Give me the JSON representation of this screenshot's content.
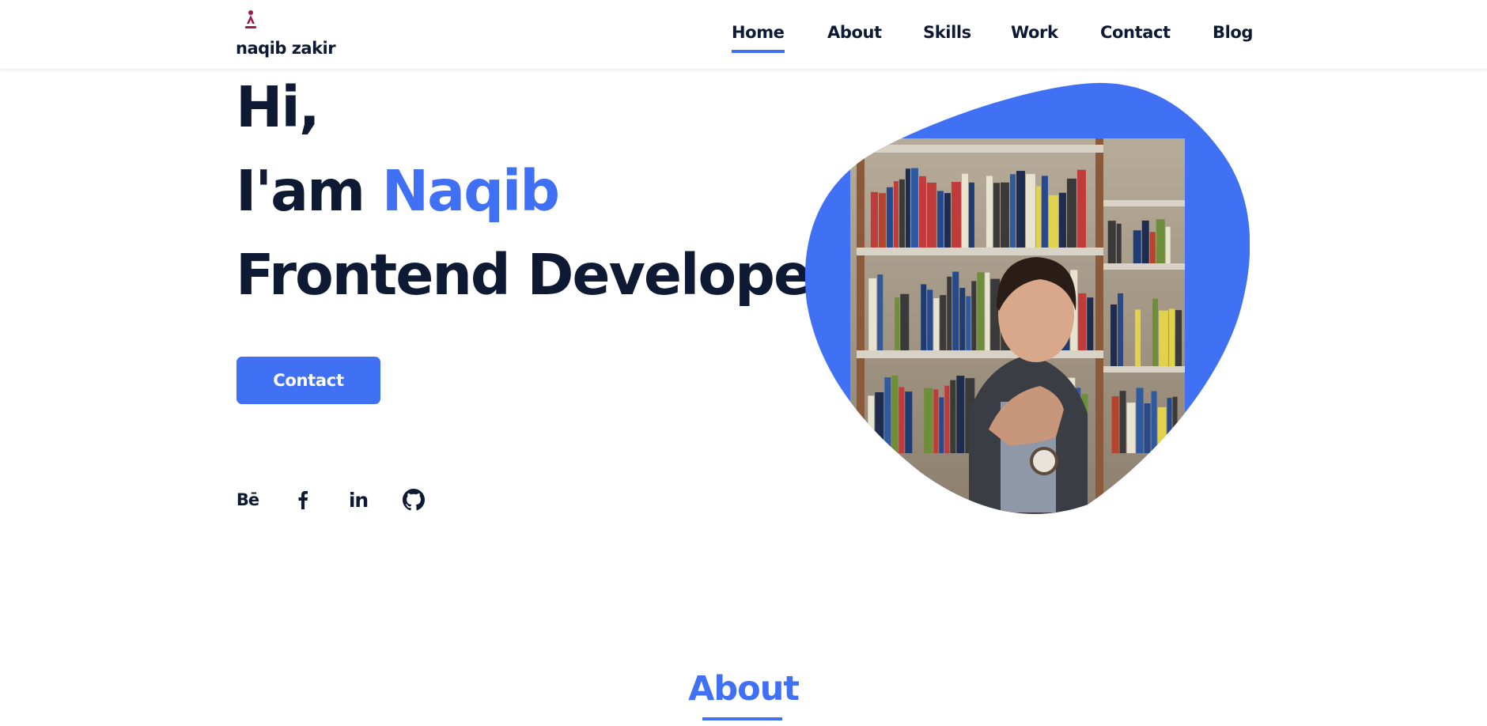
{
  "colors": {
    "accent": "#4070f4",
    "text": "#0e1a33",
    "background": "#ffffff"
  },
  "header": {
    "logo_icon": "naqib-logo-icon",
    "brand_name": "naqib zakir",
    "nav": [
      {
        "label": "Home",
        "active": true
      },
      {
        "label": "About",
        "active": false
      },
      {
        "label": "Skills",
        "active": false
      },
      {
        "label": "Work",
        "active": false
      },
      {
        "label": "Contact",
        "active": false
      },
      {
        "label": "Blog",
        "active": false
      }
    ]
  },
  "hero": {
    "line1": "Hi,",
    "line2_prefix": "I'am ",
    "line2_name": "Naqib",
    "line3": "Frontend Developer",
    "button_label": "Contact",
    "social_icons": [
      {
        "icon": "behance-icon",
        "glyph": "Bē"
      },
      {
        "icon": "facebook-icon"
      },
      {
        "icon": "linkedin-icon",
        "glyph": "in"
      },
      {
        "icon": "github-icon"
      }
    ],
    "photo_icon": "profile-photo"
  },
  "about": {
    "title": "About"
  }
}
